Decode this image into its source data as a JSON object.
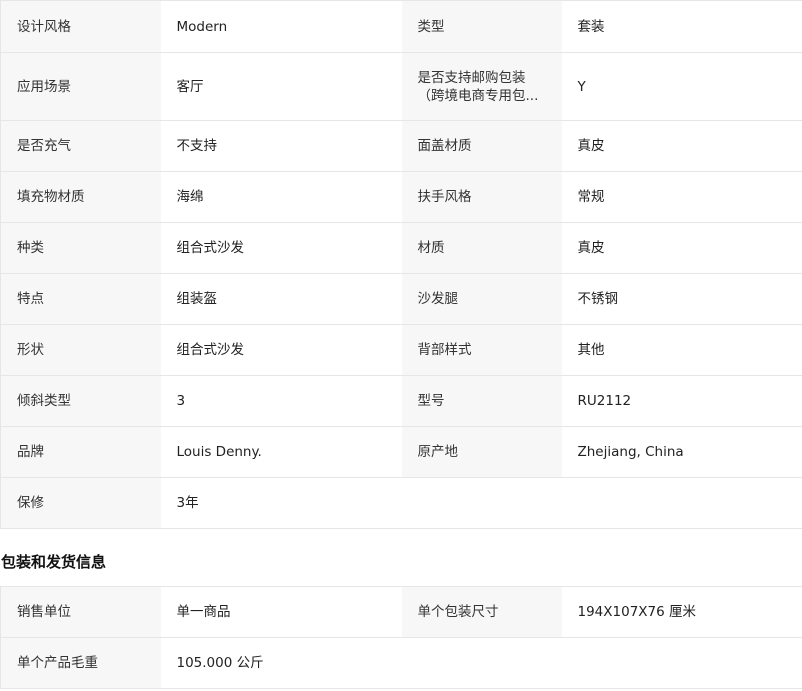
{
  "specs": {
    "rows": [
      {
        "k1": "设计风格",
        "v1": "Modern",
        "k2": "类型",
        "v2": "套装"
      },
      {
        "k1": "应用场景",
        "v1": "客厅",
        "k2": "是否支持邮购包装（跨境电商专用包...",
        "v2": "Y"
      },
      {
        "k1": "是否充气",
        "v1": "不支持",
        "k2": "面盖材质",
        "v2": "真皮"
      },
      {
        "k1": "填充物材质",
        "v1": "海绵",
        "k2": "扶手风格",
        "v2": "常规"
      },
      {
        "k1": "种类",
        "v1": "组合式沙发",
        "k2": "材质",
        "v2": "真皮"
      },
      {
        "k1": "特点",
        "v1": "组装盔",
        "k2": "沙发腿",
        "v2": "不锈钢"
      },
      {
        "k1": "形状",
        "v1": "组合式沙发",
        "k2": "背部样式",
        "v2": "其他"
      },
      {
        "k1": "倾斜类型",
        "v1": "3",
        "k2": "型号",
        "v2": "RU2112"
      },
      {
        "k1": "品牌",
        "v1": "Louis Denny.",
        "k2": "原产地",
        "v2": "Zhejiang, China"
      },
      {
        "k1": "保修",
        "v1": "3年"
      }
    ]
  },
  "packaging": {
    "title": "包装和发货信息",
    "rows": [
      {
        "k1": "销售单位",
        "v1": "单一商品",
        "k2": "单个包装尺寸",
        "v2": "194X107X76 厘米"
      },
      {
        "k1": "单个产品毛重",
        "v1": "105.000 公斤"
      }
    ]
  }
}
